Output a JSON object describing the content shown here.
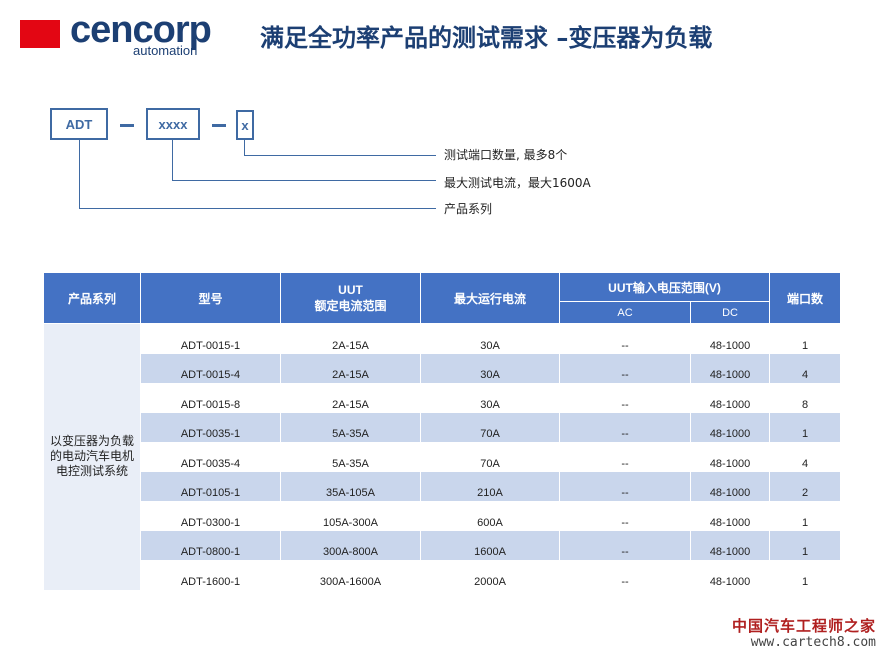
{
  "brand": {
    "name": "cencorp",
    "tagline": "automation"
  },
  "title": "满足全功率产品的测试需求 –变压器为负载",
  "code": {
    "segments": [
      "ADT",
      "xxxx",
      "x"
    ],
    "notes": [
      "测试端口数量, 最多8个",
      "最大测试电流，最大1600A",
      "产品系列"
    ]
  },
  "table": {
    "headers": {
      "series": "产品系列",
      "model": "型号",
      "current_line1": "UUT",
      "current_line2": "额定电流范围",
      "max_current": "最大运行电流",
      "voltage": "UUT输入电压范围(V)",
      "ac": "AC",
      "dc": "DC",
      "ports": "端口数"
    },
    "series_text": [
      "以变压器为负载",
      "的电动汽车电机",
      "电控测试系统"
    ],
    "rows": [
      {
        "model": "ADT-0015-1",
        "current": "2A-15A",
        "max": "30A",
        "ac": "--",
        "dc": "48-1000",
        "ports": "1"
      },
      {
        "model": "ADT-0015-4",
        "current": "2A-15A",
        "max": "30A",
        "ac": "--",
        "dc": "48-1000",
        "ports": "4"
      },
      {
        "model": "ADT-0015-8",
        "current": "2A-15A",
        "max": "30A",
        "ac": "--",
        "dc": "48-1000",
        "ports": "8"
      },
      {
        "model": "ADT-0035-1",
        "current": "5A-35A",
        "max": "70A",
        "ac": "--",
        "dc": "48-1000",
        "ports": "1"
      },
      {
        "model": "ADT-0035-4",
        "current": "5A-35A",
        "max": "70A",
        "ac": "--",
        "dc": "48-1000",
        "ports": "4"
      },
      {
        "model": "ADT-0105-1",
        "current": "35A-105A",
        "max": "210A",
        "ac": "--",
        "dc": "48-1000",
        "ports": "2"
      },
      {
        "model": "ADT-0300-1",
        "current": "105A-300A",
        "max": "600A",
        "ac": "--",
        "dc": "48-1000",
        "ports": "1"
      },
      {
        "model": "ADT-0800-1",
        "current": "300A-800A",
        "max": "1600A",
        "ac": "--",
        "dc": "48-1000",
        "ports": "1"
      },
      {
        "model": "ADT-1600-1",
        "current": "300A-1600A",
        "max": "2000A",
        "ac": "--",
        "dc": "48-1000",
        "ports": "1"
      }
    ]
  },
  "watermark": {
    "cn": "中国汽车工程师之家",
    "url": "www.cartech8.com"
  },
  "colors": {
    "brand_red": "#e30613",
    "brand_navy": "#1c3f73",
    "header_blue": "#4472c4",
    "row_band": "#c9d6ec",
    "line_blue": "#3f6aa3"
  }
}
